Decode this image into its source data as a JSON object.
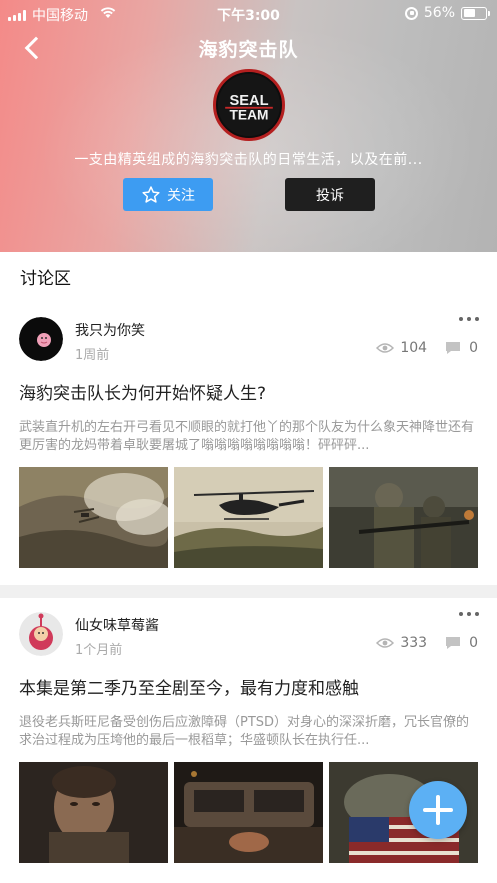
{
  "status_bar": {
    "carrier": "中国移动",
    "time": "下午3:00",
    "battery": "56%"
  },
  "header": {
    "title": "海豹突击队",
    "logo_text_1": "SEAL",
    "logo_text_2": "TEAM",
    "description": "一支由精英组成的海豹突击队的日常生活，以及在前...",
    "follow_label": "关注",
    "report_label": "投诉"
  },
  "section": {
    "title": "讨论区"
  },
  "posts": [
    {
      "author": "我只为你笑",
      "time": "1周前",
      "views": "104",
      "comments": "0",
      "title": "海豹突击队长为何开始怀疑人生?",
      "body": "武装直升机的左右开弓看见不顺眼的就打他丫的那个队友为什么象天神降世还有更厉害的龙妈带着卓耿要屠城了嗡嗡嗡嗡嗡嗡嗡嗡！砰砰砰..."
    },
    {
      "author": "仙女味草莓酱",
      "time": "1个月前",
      "views": "333",
      "comments": "0",
      "title": "本集是第二季乃至全剧至今，最有力度和感触",
      "body": "退役老兵斯旺尼备受创伤后应激障碍（PTSD）对身心的深深折磨，冗长官僚的求治过程成为压垮他的最后一根稻草；华盛顿队长在执行任..."
    }
  ],
  "colors": {
    "accent": "#3d9cf2",
    "fab": "#5cb0f4",
    "report": "#1f1f1f"
  }
}
